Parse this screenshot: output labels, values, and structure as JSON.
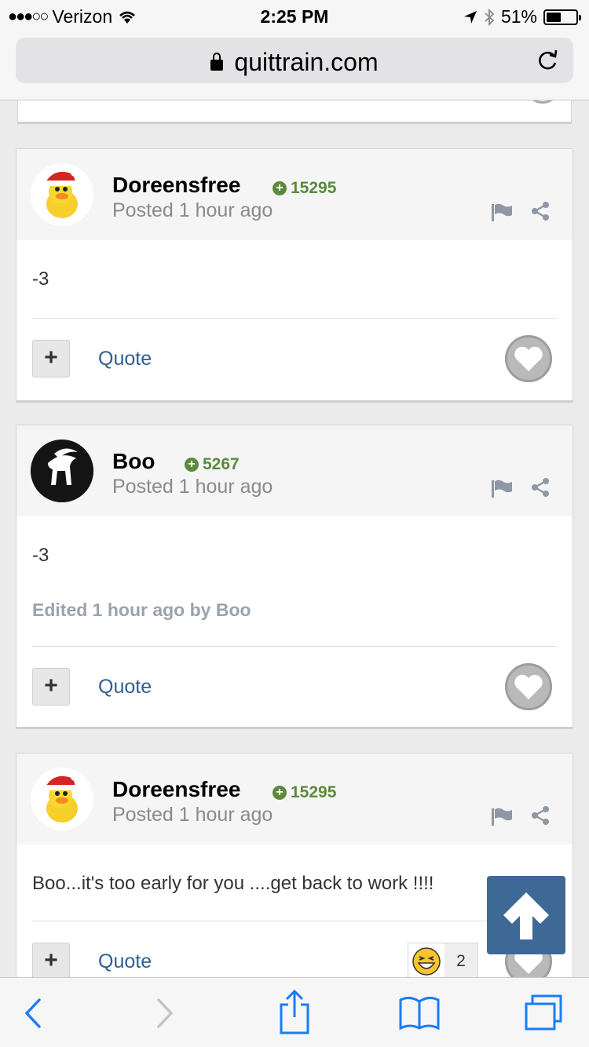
{
  "status_bar": {
    "carrier": "Verizon",
    "time": "2:25 PM",
    "battery": "51%",
    "battery_level": 0.51
  },
  "browser": {
    "url": "quittrain.com"
  },
  "posts": [
    {
      "username": "Doreensfree",
      "reputation": "15295",
      "posted": "Posted 1 hour ago",
      "body": "-3",
      "quote_label": "Quote"
    },
    {
      "username": "Boo",
      "reputation": "5267",
      "posted": "Posted 1 hour ago",
      "body": "-3",
      "edited": "Edited 1 hour ago by Boo",
      "quote_label": "Quote"
    },
    {
      "username": "Doreensfree",
      "reputation": "15295",
      "posted": "Posted 1 hour ago",
      "body": "Boo...it's too early for you ....get back to work !!!!",
      "quote_label": "Quote",
      "reaction_count": "2"
    }
  ],
  "plus_label": "+",
  "colors": {
    "accent": "#3e6896",
    "rep_green": "#5b8a3c",
    "link_blue": "#2e5f8f",
    "ios_blue": "#1a7cf5"
  },
  "icons": {
    "back": "chevron-left-icon",
    "forward": "chevron-right-icon",
    "share": "share-icon",
    "bookmarks": "book-icon",
    "tabs": "tabs-icon"
  }
}
